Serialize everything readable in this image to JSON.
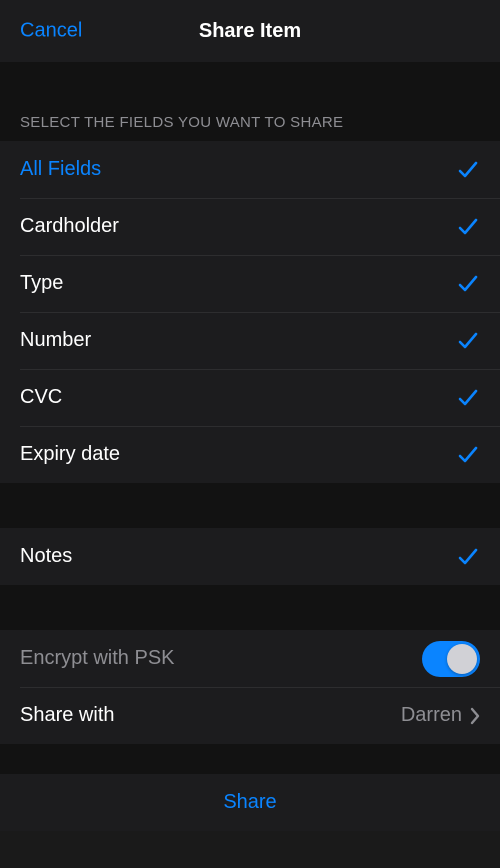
{
  "header": {
    "cancel": "Cancel",
    "title": "Share Item"
  },
  "sections": {
    "fields_header": "SELECT THE FIELDS YOU WANT TO SHARE",
    "all_fields": "All Fields",
    "items": {
      "cardholder": "Cardholder",
      "type": "Type",
      "number": "Number",
      "cvc": "CVC",
      "expiry": "Expiry date"
    },
    "notes": "Notes"
  },
  "options": {
    "encrypt_label": "Encrypt with PSK",
    "encrypt_on": true,
    "share_with_label": "Share with",
    "share_with_value": "Darren"
  },
  "actions": {
    "share": "Share"
  },
  "colors": {
    "accent": "#0a84ff",
    "background": "#121212",
    "cell_bg": "#1c1c1e",
    "muted": "#8e8e93"
  }
}
